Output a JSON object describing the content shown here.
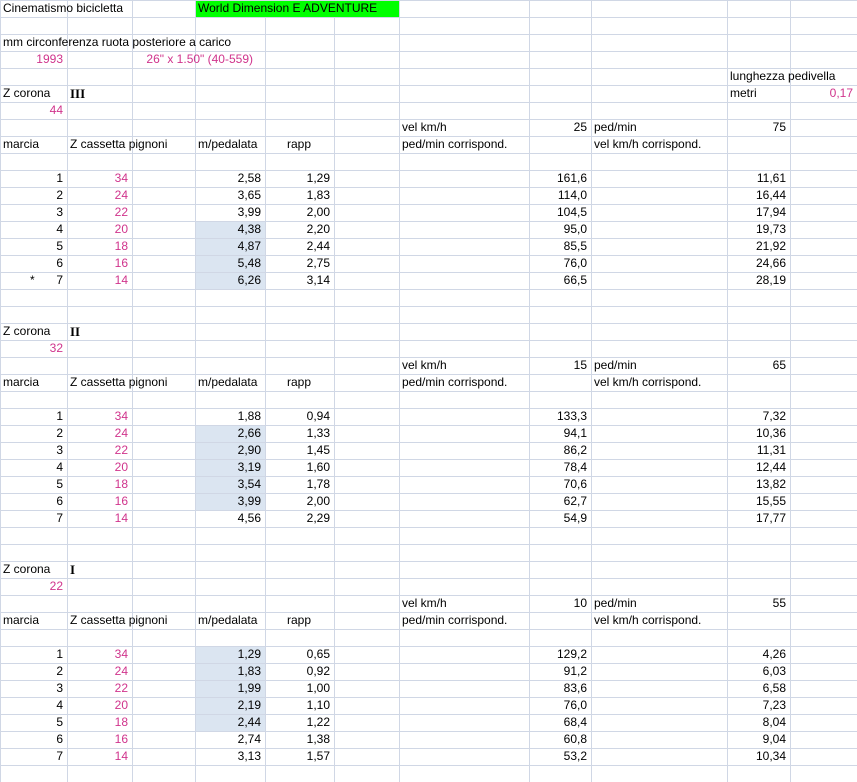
{
  "header": {
    "title": "Cinematismo bicicletta",
    "brand": "World Dimension  E ADVENTURE",
    "brand_color": "#00ff00",
    "wheel_label": "mm  circonferenza ruota posteriore a carico",
    "wheel_mm": "1993",
    "wheel_size": "26\" x 1.50\" (40-559)",
    "crank_label": "lunghezza pedivella",
    "crank_unit": "metri",
    "crank_value": "0,17"
  },
  "labels": {
    "z_corona": "Z corona",
    "vel_kmh": "vel  km/h",
    "ped_min": "ped/min",
    "marcia": "marcia",
    "z_cassetta": "Z cassetta pignoni",
    "m_pedalata": "m/pedalata",
    "rapp": "rapp",
    "ped_corr": "ped/min corrispond.",
    "vel_corr": "vel  km/h corrispond."
  },
  "accent_color": "#d0348c",
  "highlight_color": "#dbe5f1",
  "sections": [
    {
      "roman": "III",
      "z": "44",
      "vel": "25",
      "ped": "75",
      "rows": [
        {
          "mark": "",
          "marcia": "1",
          "z": "34",
          "m": "2,58",
          "rapp": "1,29",
          "pedc": "161,6",
          "velc": "11,61",
          "hl": false
        },
        {
          "mark": "",
          "marcia": "2",
          "z": "24",
          "m": "3,65",
          "rapp": "1,83",
          "pedc": "114,0",
          "velc": "16,44",
          "hl": false
        },
        {
          "mark": "",
          "marcia": "3",
          "z": "22",
          "m": "3,99",
          "rapp": "2,00",
          "pedc": "104,5",
          "velc": "17,94",
          "hl": false
        },
        {
          "mark": "",
          "marcia": "4",
          "z": "20",
          "m": "4,38",
          "rapp": "2,20",
          "pedc": "95,0",
          "velc": "19,73",
          "hl": true
        },
        {
          "mark": "",
          "marcia": "5",
          "z": "18",
          "m": "4,87",
          "rapp": "2,44",
          "pedc": "85,5",
          "velc": "21,92",
          "hl": true
        },
        {
          "mark": "",
          "marcia": "6",
          "z": "16",
          "m": "5,48",
          "rapp": "2,75",
          "pedc": "76,0",
          "velc": "24,66",
          "hl": true
        },
        {
          "mark": "*",
          "marcia": "7",
          "z": "14",
          "m": "6,26",
          "rapp": "3,14",
          "pedc": "66,5",
          "velc": "28,19",
          "hl": true
        }
      ]
    },
    {
      "roman": "II",
      "z": "32",
      "vel": "15",
      "ped": "65",
      "rows": [
        {
          "mark": "",
          "marcia": "1",
          "z": "34",
          "m": "1,88",
          "rapp": "0,94",
          "pedc": "133,3",
          "velc": "7,32",
          "hl": false
        },
        {
          "mark": "",
          "marcia": "2",
          "z": "24",
          "m": "2,66",
          "rapp": "1,33",
          "pedc": "94,1",
          "velc": "10,36",
          "hl": true
        },
        {
          "mark": "",
          "marcia": "3",
          "z": "22",
          "m": "2,90",
          "rapp": "1,45",
          "pedc": "86,2",
          "velc": "11,31",
          "hl": true
        },
        {
          "mark": "",
          "marcia": "4",
          "z": "20",
          "m": "3,19",
          "rapp": "1,60",
          "pedc": "78,4",
          "velc": "12,44",
          "hl": true
        },
        {
          "mark": "",
          "marcia": "5",
          "z": "18",
          "m": "3,54",
          "rapp": "1,78",
          "pedc": "70,6",
          "velc": "13,82",
          "hl": true
        },
        {
          "mark": "",
          "marcia": "6",
          "z": "16",
          "m": "3,99",
          "rapp": "2,00",
          "pedc": "62,7",
          "velc": "15,55",
          "hl": true
        },
        {
          "mark": "",
          "marcia": "7",
          "z": "14",
          "m": "4,56",
          "rapp": "2,29",
          "pedc": "54,9",
          "velc": "17,77",
          "hl": false
        }
      ]
    },
    {
      "roman": "I",
      "z": "22",
      "vel": "10",
      "ped": "55",
      "rows": [
        {
          "mark": "",
          "marcia": "1",
          "z": "34",
          "m": "1,29",
          "rapp": "0,65",
          "pedc": "129,2",
          "velc": "4,26",
          "hl": true
        },
        {
          "mark": "",
          "marcia": "2",
          "z": "24",
          "m": "1,83",
          "rapp": "0,92",
          "pedc": "91,2",
          "velc": "6,03",
          "hl": true
        },
        {
          "mark": "",
          "marcia": "3",
          "z": "22",
          "m": "1,99",
          "rapp": "1,00",
          "pedc": "83,6",
          "velc": "6,58",
          "hl": true
        },
        {
          "mark": "",
          "marcia": "4",
          "z": "20",
          "m": "2,19",
          "rapp": "1,10",
          "pedc": "76,0",
          "velc": "7,23",
          "hl": true
        },
        {
          "mark": "",
          "marcia": "5",
          "z": "18",
          "m": "2,44",
          "rapp": "1,22",
          "pedc": "68,4",
          "velc": "8,04",
          "hl": true
        },
        {
          "mark": "",
          "marcia": "6",
          "z": "16",
          "m": "2,74",
          "rapp": "1,38",
          "pedc": "60,8",
          "velc": "9,04",
          "hl": false
        },
        {
          "mark": "",
          "marcia": "7",
          "z": "14",
          "m": "3,13",
          "rapp": "1,57",
          "pedc": "53,2",
          "velc": "10,34",
          "hl": false
        }
      ]
    }
  ]
}
